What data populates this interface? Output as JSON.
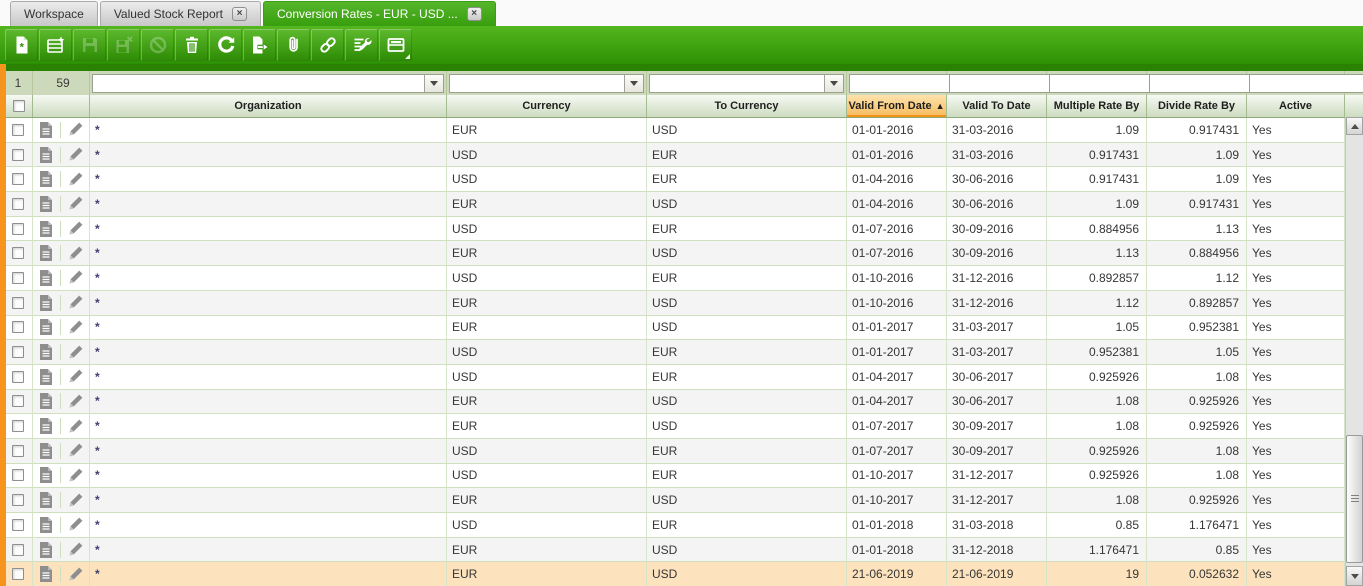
{
  "window": {
    "tabs": [
      {
        "label": "Workspace",
        "active": false,
        "closable": false
      },
      {
        "label": "Valued Stock Report",
        "active": false,
        "closable": true,
        "close_glyph": "×"
      },
      {
        "label": "Conversion Rates - EUR - USD ...",
        "active": true,
        "closable": true,
        "close_glyph": "×"
      }
    ]
  },
  "toolbar": {
    "buttons": [
      {
        "icon": "new-document-icon",
        "enabled": true
      },
      {
        "icon": "new-row-icon",
        "enabled": true
      },
      {
        "icon": "save-icon",
        "enabled": false
      },
      {
        "icon": "save-and-close-icon",
        "enabled": false
      },
      {
        "icon": "undo-icon",
        "enabled": false
      },
      {
        "icon": "delete-icon",
        "enabled": true
      },
      {
        "icon": "refresh-icon",
        "enabled": true
      },
      {
        "icon": "export-icon",
        "enabled": true
      },
      {
        "icon": "attachment-icon",
        "enabled": true
      },
      {
        "icon": "link-icon",
        "enabled": true
      },
      {
        "icon": "grid-settings-icon",
        "enabled": true
      },
      {
        "icon": "form-view-icon",
        "enabled": true
      }
    ]
  },
  "grid": {
    "pager": {
      "current_row": "1",
      "total_rows": "59"
    },
    "columns": [
      {
        "label": "Organization"
      },
      {
        "label": "Currency"
      },
      {
        "label": "To Currency"
      },
      {
        "label": "Valid From Date",
        "sorted": true,
        "sort_arrow": "▲"
      },
      {
        "label": "Valid To Date"
      },
      {
        "label": "Multiple Rate By"
      },
      {
        "label": "Divide Rate By"
      },
      {
        "label": "Active"
      }
    ],
    "selected_row_index": 18,
    "rows": [
      {
        "organization": "*",
        "currency": "EUR",
        "to_currency": "USD",
        "valid_from": "01-01-2016",
        "valid_to": "31-03-2016",
        "multiple_rate": "1.09",
        "divide_rate": "0.917431",
        "active": "Yes"
      },
      {
        "organization": "*",
        "currency": "USD",
        "to_currency": "EUR",
        "valid_from": "01-01-2016",
        "valid_to": "31-03-2016",
        "multiple_rate": "0.917431",
        "divide_rate": "1.09",
        "active": "Yes"
      },
      {
        "organization": "*",
        "currency": "USD",
        "to_currency": "EUR",
        "valid_from": "01-04-2016",
        "valid_to": "30-06-2016",
        "multiple_rate": "0.917431",
        "divide_rate": "1.09",
        "active": "Yes"
      },
      {
        "organization": "*",
        "currency": "EUR",
        "to_currency": "USD",
        "valid_from": "01-04-2016",
        "valid_to": "30-06-2016",
        "multiple_rate": "1.09",
        "divide_rate": "0.917431",
        "active": "Yes"
      },
      {
        "organization": "*",
        "currency": "USD",
        "to_currency": "EUR",
        "valid_from": "01-07-2016",
        "valid_to": "30-09-2016",
        "multiple_rate": "0.884956",
        "divide_rate": "1.13",
        "active": "Yes"
      },
      {
        "organization": "*",
        "currency": "EUR",
        "to_currency": "USD",
        "valid_from": "01-07-2016",
        "valid_to": "30-09-2016",
        "multiple_rate": "1.13",
        "divide_rate": "0.884956",
        "active": "Yes"
      },
      {
        "organization": "*",
        "currency": "USD",
        "to_currency": "EUR",
        "valid_from": "01-10-2016",
        "valid_to": "31-12-2016",
        "multiple_rate": "0.892857",
        "divide_rate": "1.12",
        "active": "Yes"
      },
      {
        "organization": "*",
        "currency": "EUR",
        "to_currency": "USD",
        "valid_from": "01-10-2016",
        "valid_to": "31-12-2016",
        "multiple_rate": "1.12",
        "divide_rate": "0.892857",
        "active": "Yes"
      },
      {
        "organization": "*",
        "currency": "EUR",
        "to_currency": "USD",
        "valid_from": "01-01-2017",
        "valid_to": "31-03-2017",
        "multiple_rate": "1.05",
        "divide_rate": "0.952381",
        "active": "Yes"
      },
      {
        "organization": "*",
        "currency": "USD",
        "to_currency": "EUR",
        "valid_from": "01-01-2017",
        "valid_to": "31-03-2017",
        "multiple_rate": "0.952381",
        "divide_rate": "1.05",
        "active": "Yes"
      },
      {
        "organization": "*",
        "currency": "USD",
        "to_currency": "EUR",
        "valid_from": "01-04-2017",
        "valid_to": "30-06-2017",
        "multiple_rate": "0.925926",
        "divide_rate": "1.08",
        "active": "Yes"
      },
      {
        "organization": "*",
        "currency": "EUR",
        "to_currency": "USD",
        "valid_from": "01-04-2017",
        "valid_to": "30-06-2017",
        "multiple_rate": "1.08",
        "divide_rate": "0.925926",
        "active": "Yes"
      },
      {
        "organization": "*",
        "currency": "EUR",
        "to_currency": "USD",
        "valid_from": "01-07-2017",
        "valid_to": "30-09-2017",
        "multiple_rate": "1.08",
        "divide_rate": "0.925926",
        "active": "Yes"
      },
      {
        "organization": "*",
        "currency": "USD",
        "to_currency": "EUR",
        "valid_from": "01-07-2017",
        "valid_to": "30-09-2017",
        "multiple_rate": "0.925926",
        "divide_rate": "1.08",
        "active": "Yes"
      },
      {
        "organization": "*",
        "currency": "USD",
        "to_currency": "EUR",
        "valid_from": "01-10-2017",
        "valid_to": "31-12-2017",
        "multiple_rate": "0.925926",
        "divide_rate": "1.08",
        "active": "Yes"
      },
      {
        "organization": "*",
        "currency": "EUR",
        "to_currency": "USD",
        "valid_from": "01-10-2017",
        "valid_to": "31-12-2017",
        "multiple_rate": "1.08",
        "divide_rate": "0.925926",
        "active": "Yes"
      },
      {
        "organization": "*",
        "currency": "USD",
        "to_currency": "EUR",
        "valid_from": "01-01-2018",
        "valid_to": "31-03-2018",
        "multiple_rate": "0.85",
        "divide_rate": "1.176471",
        "active": "Yes"
      },
      {
        "organization": "*",
        "currency": "EUR",
        "to_currency": "USD",
        "valid_from": "01-01-2018",
        "valid_to": "31-12-2018",
        "multiple_rate": "1.176471",
        "divide_rate": "0.85",
        "active": "Yes"
      },
      {
        "organization": "*",
        "currency": "EUR",
        "to_currency": "USD",
        "valid_from": "21-06-2019",
        "valid_to": "21-06-2019",
        "multiple_rate": "19",
        "divide_rate": "0.052632",
        "active": "Yes"
      }
    ]
  },
  "colors": {
    "accent_green": "#389f0d",
    "toolbar_green_top": "#54b71f",
    "toolbar_green_bottom": "#2e9003",
    "sorted_header_orange": "#f6ba5e",
    "selected_row": "#fce3bd",
    "left_stripe_orange": "#f7941d",
    "filter_row_sage": "#ccd9ba"
  }
}
